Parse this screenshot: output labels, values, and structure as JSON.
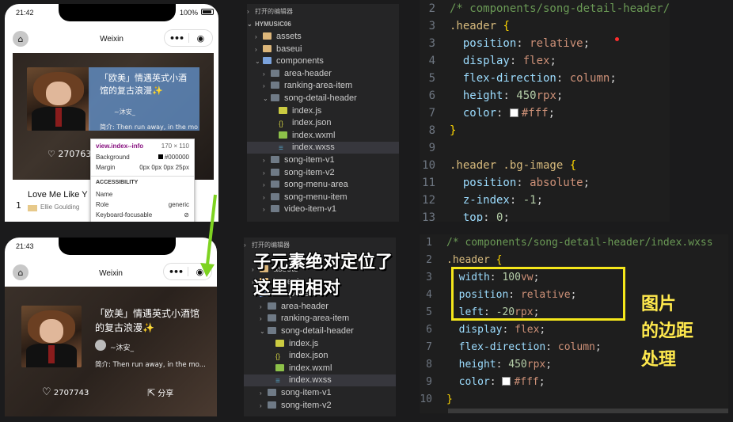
{
  "top": {
    "phone": {
      "status_time": "21:42",
      "status_battery": "100%",
      "nav_title": "Weixin",
      "song_title": "「欧美」情遇英式小酒馆的复古浪漫✨",
      "author": "~沐安_",
      "desc": "简介: Then run away, in the mo",
      "like_count": "270763",
      "list_title": "Love Me Like Y",
      "list_artist": "Ellie Goulding",
      "list_index": "1",
      "devtools": {
        "selector": "view.index--info",
        "size": "170 × 110",
        "background_label": "Background",
        "background_value": "#000000",
        "margin_label": "Margin",
        "margin_value": "0px 0px 0px 25px",
        "section": "ACCESSIBILITY",
        "name_label": "Name",
        "role_label": "Role",
        "role_value": "generic",
        "kf_label": "Keyboard-focusable"
      }
    },
    "explorer": {
      "open_editors": "打开的编辑器",
      "project": "HYMUSIC06",
      "items": [
        {
          "label": "assets",
          "type": "folder",
          "arrow": "›",
          "indent": 1
        },
        {
          "label": "baseui",
          "type": "folder",
          "arrow": "›",
          "indent": 1
        },
        {
          "label": "components",
          "type": "folder-src",
          "arrow": "⌄",
          "indent": 1
        },
        {
          "label": "area-header",
          "type": "folder-dark",
          "arrow": "›",
          "indent": 2
        },
        {
          "label": "ranking-area-item",
          "type": "folder-dark",
          "arrow": "›",
          "indent": 2
        },
        {
          "label": "song-detail-header",
          "type": "folder-dark",
          "arrow": "⌄",
          "indent": 2
        },
        {
          "label": "index.js",
          "type": "js",
          "arrow": "",
          "indent": 3
        },
        {
          "label": "index.json",
          "type": "json",
          "arrow": "",
          "indent": 3
        },
        {
          "label": "index.wxml",
          "type": "wxml",
          "arrow": "",
          "indent": 3
        },
        {
          "label": "index.wxss",
          "type": "wxss",
          "arrow": "",
          "indent": 3,
          "selected": true
        },
        {
          "label": "song-item-v1",
          "type": "folder-dark",
          "arrow": "›",
          "indent": 2
        },
        {
          "label": "song-item-v2",
          "type": "folder-dark",
          "arrow": "›",
          "indent": 2
        },
        {
          "label": "song-menu-area",
          "type": "folder-dark",
          "arrow": "›",
          "indent": 2
        },
        {
          "label": "song-menu-item",
          "type": "folder-dark",
          "arrow": "›",
          "indent": 2
        },
        {
          "label": "video-item-v1",
          "type": "folder-dark",
          "arrow": "›",
          "indent": 2
        }
      ]
    },
    "editor": {
      "lines": [
        {
          "n": "2",
          "tokens": [
            [
              "c-comment",
              "/* components/song-detail-header/"
            ]
          ]
        },
        {
          "n": "3",
          "tokens": [
            [
              "c-sel",
              ".header"
            ],
            [
              "c-punc",
              " "
            ],
            [
              "c-brace",
              "{"
            ]
          ]
        },
        {
          "n": "3",
          "tokens": [
            [
              "c-punc",
              "  "
            ],
            [
              "c-prop",
              "position"
            ],
            [
              "c-punc",
              ": "
            ],
            [
              "c-val",
              "relative"
            ],
            [
              "c-punc",
              ";"
            ]
          ]
        },
        {
          "n": "4",
          "tokens": [
            [
              "c-punc",
              "  "
            ],
            [
              "c-prop",
              "display"
            ],
            [
              "c-punc",
              ": "
            ],
            [
              "c-val",
              "flex"
            ],
            [
              "c-punc",
              ";"
            ]
          ]
        },
        {
          "n": "5",
          "tokens": [
            [
              "c-punc",
              "  "
            ],
            [
              "c-prop",
              "flex-direction"
            ],
            [
              "c-punc",
              ": "
            ],
            [
              "c-val",
              "column"
            ],
            [
              "c-punc",
              ";"
            ]
          ]
        },
        {
          "n": "6",
          "tokens": [
            [
              "c-punc",
              "  "
            ],
            [
              "c-prop",
              "height"
            ],
            [
              "c-punc",
              ": "
            ],
            [
              "c-num",
              "450"
            ],
            [
              "c-val",
              "rpx"
            ],
            [
              "c-punc",
              ";"
            ]
          ]
        },
        {
          "n": "7",
          "tokens": [
            [
              "c-punc",
              "  "
            ],
            [
              "c-prop",
              "color"
            ],
            [
              "c-punc",
              ": "
            ],
            [
              "swatch",
              ""
            ],
            [
              "c-val",
              "#fff"
            ],
            [
              "c-punc",
              ";"
            ]
          ]
        },
        {
          "n": "8",
          "tokens": [
            [
              "c-brace",
              "}"
            ]
          ]
        },
        {
          "n": "9",
          "tokens": []
        },
        {
          "n": "10",
          "tokens": [
            [
              "c-sel",
              ".header .bg-image"
            ],
            [
              "c-punc",
              " "
            ],
            [
              "c-brace",
              "{"
            ]
          ]
        },
        {
          "n": "11",
          "tokens": [
            [
              "c-punc",
              "  "
            ],
            [
              "c-prop",
              "position"
            ],
            [
              "c-punc",
              ": "
            ],
            [
              "c-val",
              "absolute"
            ],
            [
              "c-punc",
              ";"
            ]
          ]
        },
        {
          "n": "12",
          "tokens": [
            [
              "c-punc",
              "  "
            ],
            [
              "c-prop",
              "z-index"
            ],
            [
              "c-punc",
              ": "
            ],
            [
              "c-num",
              "-1"
            ],
            [
              "c-punc",
              ";"
            ]
          ]
        },
        {
          "n": "13",
          "tokens": [
            [
              "c-punc",
              "  "
            ],
            [
              "c-prop",
              "top"
            ],
            [
              "c-punc",
              ": "
            ],
            [
              "c-num",
              "0"
            ],
            [
              "c-punc",
              ";"
            ]
          ]
        }
      ]
    }
  },
  "bottom": {
    "phone": {
      "status_time": "21:43",
      "nav_title": "Weixin",
      "song_title_1": "「欧美」情遇英式小酒馆",
      "song_title_2": "的复古浪漫✨",
      "author": "~沐安_",
      "desc": "简介: Then run away, in the mo...",
      "like_count": "2707743",
      "share_label": "分享"
    },
    "explorer": {
      "open_editors": "打开的编辑器",
      "items": [
        {
          "label": "assets",
          "type": "folder",
          "arrow": "›",
          "indent": 1
        },
        {
          "label": "baseui",
          "type": "folder",
          "arrow": "›",
          "indent": 1
        },
        {
          "label": "components",
          "type": "folder-src",
          "arrow": "⌄",
          "indent": 1
        },
        {
          "label": "area-header",
          "type": "folder-dark",
          "arrow": "›",
          "indent": 2
        },
        {
          "label": "ranking-area-item",
          "type": "folder-dark",
          "arrow": "›",
          "indent": 2
        },
        {
          "label": "song-detail-header",
          "type": "folder-dark",
          "arrow": "⌄",
          "indent": 2
        },
        {
          "label": "index.js",
          "type": "js",
          "arrow": "",
          "indent": 3
        },
        {
          "label": "index.json",
          "type": "json",
          "arrow": "",
          "indent": 3
        },
        {
          "label": "index.wxml",
          "type": "wxml",
          "arrow": "",
          "indent": 3
        },
        {
          "label": "index.wxss",
          "type": "wxss",
          "arrow": "",
          "indent": 3,
          "selected": true
        },
        {
          "label": "song-item-v1",
          "type": "folder-dark",
          "arrow": "›",
          "indent": 2
        },
        {
          "label": "song-item-v2",
          "type": "folder-dark",
          "arrow": "›",
          "indent": 2
        }
      ]
    },
    "editor": {
      "lines": [
        {
          "n": "1",
          "tokens": [
            [
              "c-comment",
              "/* components/song-detail-header/index.wxss"
            ]
          ]
        },
        {
          "n": "2",
          "tokens": [
            [
              "c-sel",
              ".header"
            ],
            [
              "c-punc",
              " "
            ],
            [
              "c-brace",
              "{"
            ]
          ]
        },
        {
          "n": "3",
          "tokens": [
            [
              "c-punc",
              "  "
            ],
            [
              "c-prop",
              "width"
            ],
            [
              "c-punc",
              ": "
            ],
            [
              "c-num",
              "100"
            ],
            [
              "c-val",
              "vw"
            ],
            [
              "c-punc",
              ";"
            ]
          ]
        },
        {
          "n": "4",
          "tokens": [
            [
              "c-punc",
              "  "
            ],
            [
              "c-prop",
              "position"
            ],
            [
              "c-punc",
              ": "
            ],
            [
              "c-val",
              "relative"
            ],
            [
              "c-punc",
              ";"
            ]
          ]
        },
        {
          "n": "5",
          "tokens": [
            [
              "c-punc",
              "  "
            ],
            [
              "c-prop",
              "left"
            ],
            [
              "c-punc",
              ": "
            ],
            [
              "c-num",
              "-20"
            ],
            [
              "c-val",
              "rpx"
            ],
            [
              "c-punc",
              ";"
            ]
          ]
        },
        {
          "n": "6",
          "tokens": [
            [
              "c-punc",
              "  "
            ],
            [
              "c-prop",
              "display"
            ],
            [
              "c-punc",
              ": "
            ],
            [
              "c-val",
              "flex"
            ],
            [
              "c-punc",
              ";"
            ]
          ]
        },
        {
          "n": "7",
          "tokens": [
            [
              "c-punc",
              "  "
            ],
            [
              "c-prop",
              "flex-direction"
            ],
            [
              "c-punc",
              ": "
            ],
            [
              "c-val",
              "column"
            ],
            [
              "c-punc",
              ";"
            ]
          ]
        },
        {
          "n": "8",
          "tokens": [
            [
              "c-punc",
              "  "
            ],
            [
              "c-prop",
              "height"
            ],
            [
              "c-punc",
              ": "
            ],
            [
              "c-num",
              "450"
            ],
            [
              "c-val",
              "rpx"
            ],
            [
              "c-punc",
              ";"
            ]
          ]
        },
        {
          "n": "9",
          "tokens": [
            [
              "c-punc",
              "  "
            ],
            [
              "c-prop",
              "color"
            ],
            [
              "c-punc",
              ": "
            ],
            [
              "swatch",
              ""
            ],
            [
              "c-val",
              "#fff"
            ],
            [
              "c-punc",
              ";"
            ]
          ]
        },
        {
          "n": "10",
          "tokens": [
            [
              "c-brace",
              "}"
            ]
          ]
        }
      ]
    }
  },
  "annotations": {
    "child_abs_line1": "子元素绝对定位了",
    "child_abs_line2": "这里用相对",
    "img_margin_line1": "图片",
    "img_margin_line2": "的边距",
    "img_margin_line3": "处理"
  },
  "colors": {
    "highlight_box": "#f5e71b",
    "arrow": "#7ed321",
    "cursor_dot": "#ff2d2d"
  }
}
